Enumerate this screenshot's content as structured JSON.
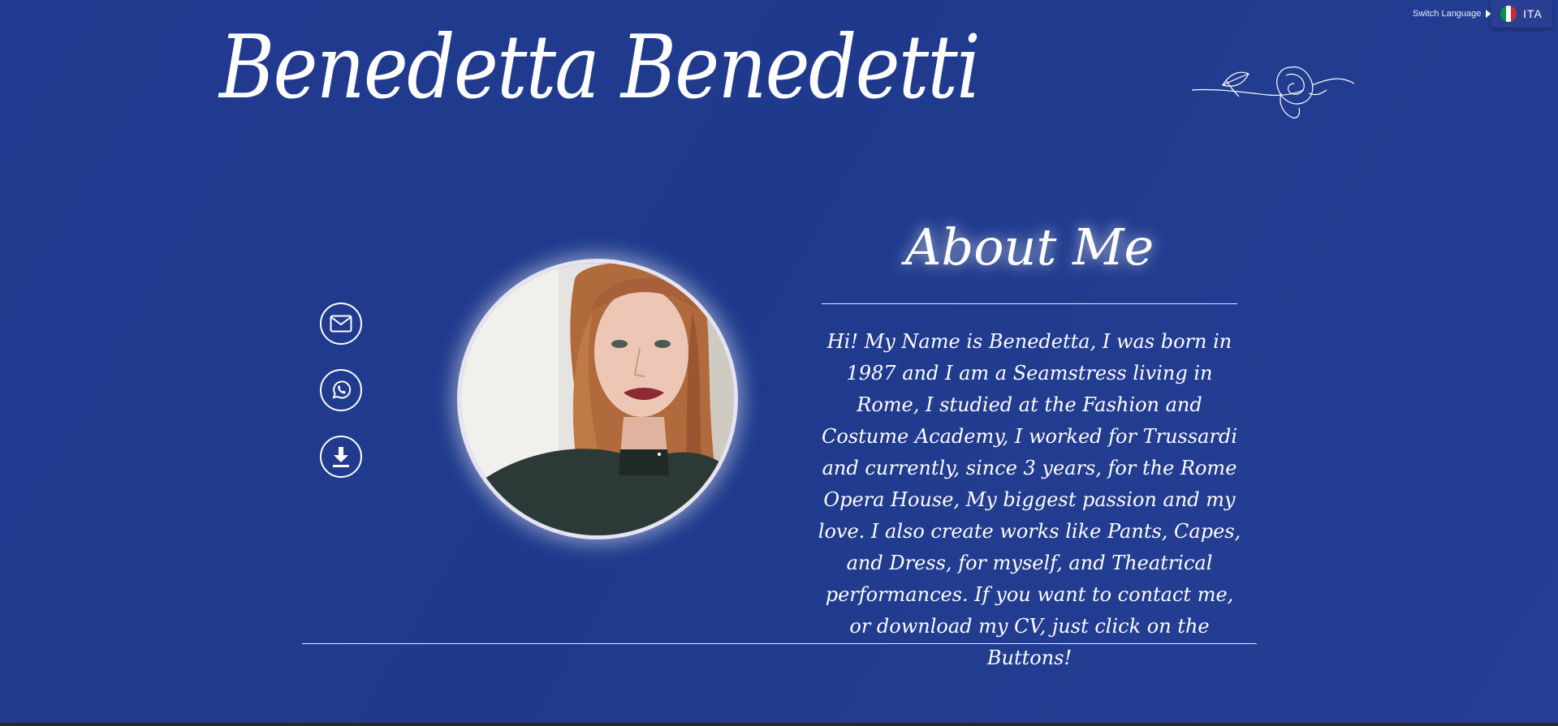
{
  "header": {
    "title": "Benedetta Benedetti",
    "switch_language_label": "Switch Language",
    "language_code": "ITA",
    "flag_colors": [
      "#009246",
      "#ffffff",
      "#ce2b37"
    ]
  },
  "contacts": [
    {
      "name": "email",
      "icon": "envelope-icon"
    },
    {
      "name": "whatsapp",
      "icon": "whatsapp-icon"
    },
    {
      "name": "download-cv",
      "icon": "download-icon"
    }
  ],
  "about": {
    "title": "About Me",
    "text": "Hi! My Name is Benedetta, I was born in 1987 and I am a Seamstress living in Rome, I studied at the Fashion and Costume Academy, I worked for Trussardi and currently, since 3 years, for the Rome Opera House, My biggest passion and my love. I also create works like Pants, Capes, and Dress, for myself, and Theatrical performances. If you want to contact me, or download my CV, just click on the Buttons!"
  },
  "colors": {
    "background": "#22398f",
    "accent": "#ffffff"
  }
}
